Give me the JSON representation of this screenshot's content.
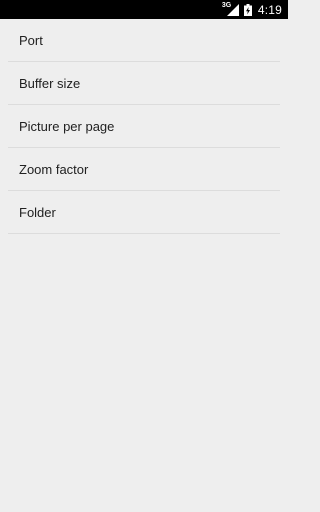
{
  "status_bar": {
    "network_type": "3G",
    "signal_icon": "signal-icon",
    "battery_icon": "battery-charging-icon",
    "time": "4:19"
  },
  "settings": {
    "items": [
      {
        "label": "Port"
      },
      {
        "label": "Buffer size"
      },
      {
        "label": "Picture per page"
      },
      {
        "label": "Zoom factor"
      },
      {
        "label": "Folder"
      }
    ]
  },
  "colors": {
    "background": "#eeeeee",
    "status_bar": "#000000",
    "divider": "#dcdcdc",
    "text": "#212121"
  }
}
